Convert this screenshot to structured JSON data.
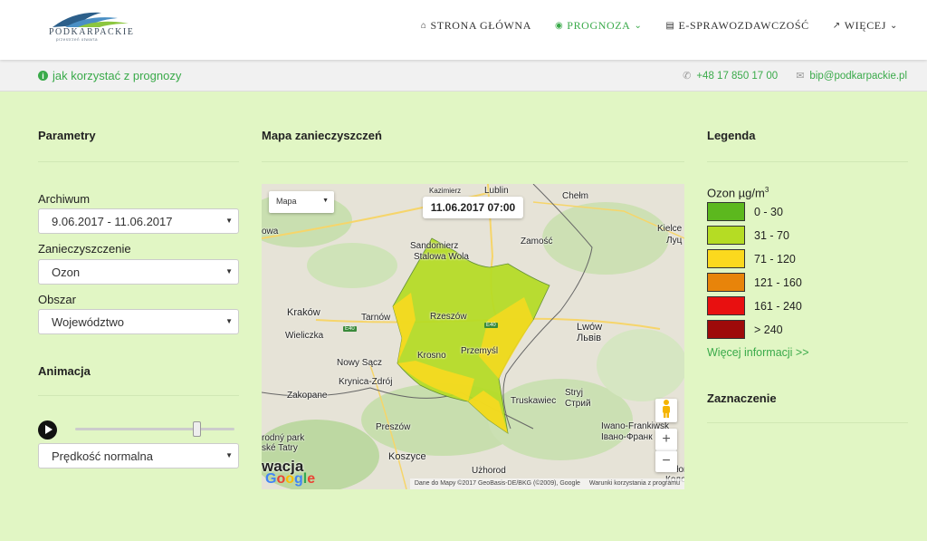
{
  "header": {
    "logo_text": "PODKARPACKIE",
    "logo_subtext": "przestrzeń otwarta",
    "nav": [
      {
        "label": "STRONA GŁÓWNA",
        "icon": "home-icon"
      },
      {
        "label": "PROGNOZA",
        "icon": "eye-icon",
        "active": true,
        "dropdown": true
      },
      {
        "label": "E-SPRAWOZDAWCZOŚĆ",
        "icon": "document-icon"
      },
      {
        "label": "WIĘCEJ",
        "icon": "external-link-icon",
        "dropdown": true
      }
    ]
  },
  "subbar": {
    "help_text": "jak korzystać z prognozy",
    "phone": "+48 17 850 17 00",
    "email": "bip@podkarpackie.pl"
  },
  "params": {
    "title": "Parametry",
    "archive_label": "Archiwum",
    "archive_value": "9.06.2017 - 11.06.2017",
    "pollutant_label": "Zanieczyszczenie",
    "pollutant_value": "Ozon",
    "area_label": "Obszar",
    "area_value": "Województwo",
    "animation_title": "Animacja",
    "slider_position": 0.76,
    "speed_value": "Prędkość normalna"
  },
  "map": {
    "title": "Mapa zanieczyszczeń",
    "type_label": "Mapa",
    "timestamp": "11.06.2017 07:00",
    "attribution_data": "Dane do Mapy ©2017 GeoBasis-DE/BKG (©2009), Google",
    "attribution_terms": "Warunki korzystania z programu",
    "google": "Google",
    "cities": {
      "lublin": "Lublin",
      "kazimierz": "Kazimierz",
      "chelm": "Chełm",
      "kielce": "Kielce",
      "zamosc": "Zamość",
      "lutsk": "Луц",
      "sandomierz": "Sandomierz",
      "stalowa_wola": "Stalowa Wola",
      "owa": "owa",
      "krakow": "Kraków",
      "tarnow": "Tarnów",
      "rzeszow": "Rzeszów",
      "lwow": "Lwów",
      "lviv": "Львів",
      "wieliczka": "Wieliczka",
      "przemysl": "Przemyśl",
      "krosno": "Krosno",
      "nowy_sacz": "Nowy Sącz",
      "krynica": "Krynica-Zdrój",
      "zakopane": "Zakopane",
      "truskawiec": "Truskawiec",
      "stryj": "Stryj",
      "stryj_ua": "Стрий",
      "preszow": "Preszów",
      "tatry_1": "rodný park",
      "tatry_2": "ské Tatry",
      "koszyce": "Koszyce",
      "uzhorod": "Użhorod",
      "iwano": "Iwano-Frankiwsk",
      "ivano_ua": "Івано-Франк",
      "kolomyja": "Kołomyja",
      "kolomyja_ua": "Колом",
      "slowacja": "wacja",
      "e40": "E40"
    }
  },
  "legend": {
    "title": "Legenda",
    "ozon_label": "Ozon µg/m",
    "ozon_sup": "3",
    "items": [
      {
        "range": "0 - 30",
        "color": "#5cb81e"
      },
      {
        "range": "31 - 70",
        "color": "#b5dc24"
      },
      {
        "range": "71 - 120",
        "color": "#fbd91e"
      },
      {
        "range": "121 - 160",
        "color": "#e8840a"
      },
      {
        "range": "161 - 240",
        "color": "#e81010"
      },
      {
        "range": "> 240",
        "color": "#9e0a0a"
      }
    ],
    "more_link": "Więcej informacji >>",
    "selection_title": "Zaznaczenie"
  }
}
